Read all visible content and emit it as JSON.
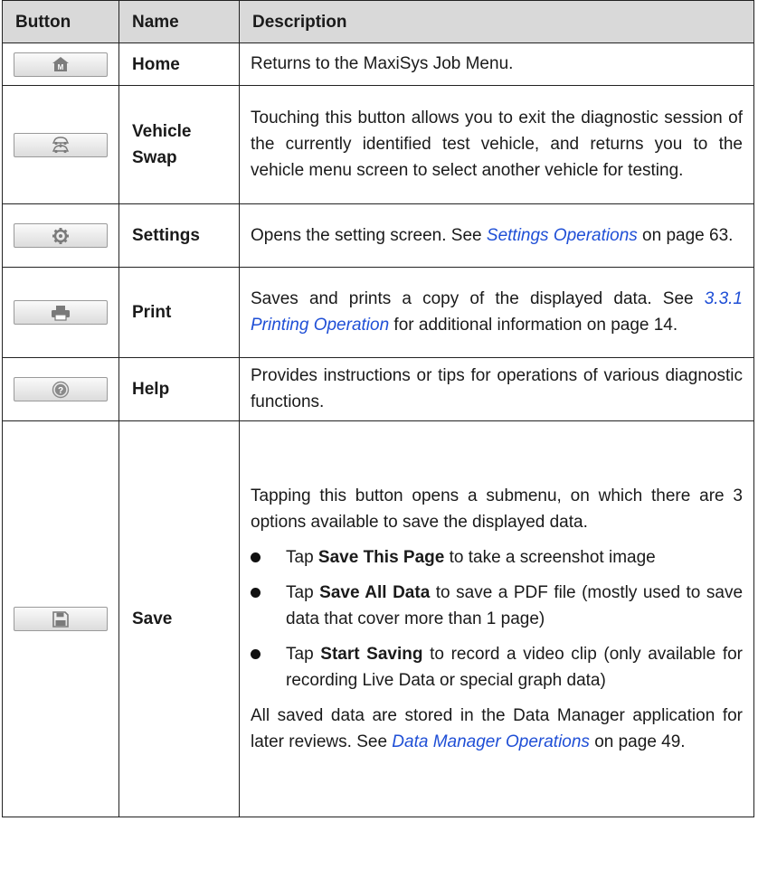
{
  "headers": {
    "button": "Button",
    "name": "Name",
    "description": "Description"
  },
  "rows": {
    "home": {
      "icon": "home-icon",
      "name": "Home",
      "desc": "Returns to the MaxiSys Job Menu."
    },
    "vehicle_swap": {
      "icon": "vehicle-swap-icon",
      "name_line1": "Vehicle",
      "name_line2": "Swap",
      "desc": "Touching this button allows you to exit the diagnostic session of the currently identified test vehicle, and returns you to the vehicle menu screen to select another vehicle for testing."
    },
    "settings": {
      "icon": "gear-icon",
      "name": "Settings",
      "desc_pre": "Opens the setting screen. See ",
      "desc_link": "Settings Operations",
      "desc_post": " on page 63."
    },
    "print": {
      "icon": "printer-icon",
      "name": "Print",
      "desc_pre": "Saves and prints a copy of the displayed data. See ",
      "desc_link": "3.3.1 Printing Operation",
      "desc_post": " for additional information on page 14."
    },
    "help": {
      "icon": "help-icon",
      "name": "Help",
      "desc": "Provides instructions or tips for operations of various diagnostic functions."
    },
    "save": {
      "icon": "floppy-disk-icon",
      "name": "Save",
      "desc_intro": "Tapping this button opens a submenu, on which there are 3 options available to save the displayed data.",
      "options": [
        {
          "tap": "Tap ",
          "bold": "Save This Page",
          "rest": " to take a screenshot image"
        },
        {
          "tap": "Tap ",
          "bold": "Save All Data",
          "rest": " to save a PDF file (mostly used to save data that cover more than 1 page)"
        },
        {
          "tap": "Tap ",
          "bold": "Start Saving",
          "rest": " to record a video clip (only available for recording Live Data or special graph data)"
        }
      ],
      "after_pre": "All saved data are stored in the Data Manager application for later reviews. See ",
      "after_link": "Data Manager Operations",
      "after_post": " on page 49."
    }
  }
}
